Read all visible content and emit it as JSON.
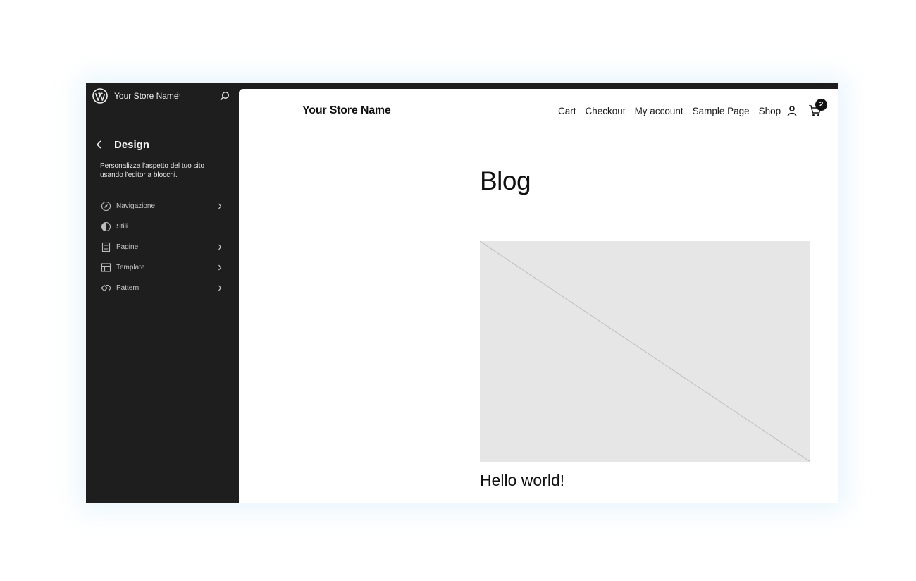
{
  "sidebar": {
    "site_name": "Your Store Name",
    "title": "Design",
    "description": "Personalizza l'aspetto del tuo sito usando l'editor a blocchi.",
    "items": [
      {
        "label": "Navigazione",
        "icon": "navigation-icon",
        "has_chevron": true
      },
      {
        "label": "Stili",
        "icon": "styles-icon",
        "has_chevron": false
      },
      {
        "label": "Pagine",
        "icon": "page-icon",
        "has_chevron": true
      },
      {
        "label": "Template",
        "icon": "template-icon",
        "has_chevron": true
      },
      {
        "label": "Pattern",
        "icon": "pattern-icon",
        "has_chevron": true
      }
    ]
  },
  "preview": {
    "store_title": "Your Store Name",
    "nav": [
      "Cart",
      "Checkout",
      "My account",
      "Sample Page",
      "Shop"
    ],
    "cart_count": "2",
    "page_title": "Blog",
    "post_title": "Hello world!"
  },
  "colors": {
    "sidebar_bg": "#1e1e1e",
    "canvas_bg": "#ffffff",
    "placeholder_bg": "#e6e6e6",
    "text_dark": "#111111"
  }
}
